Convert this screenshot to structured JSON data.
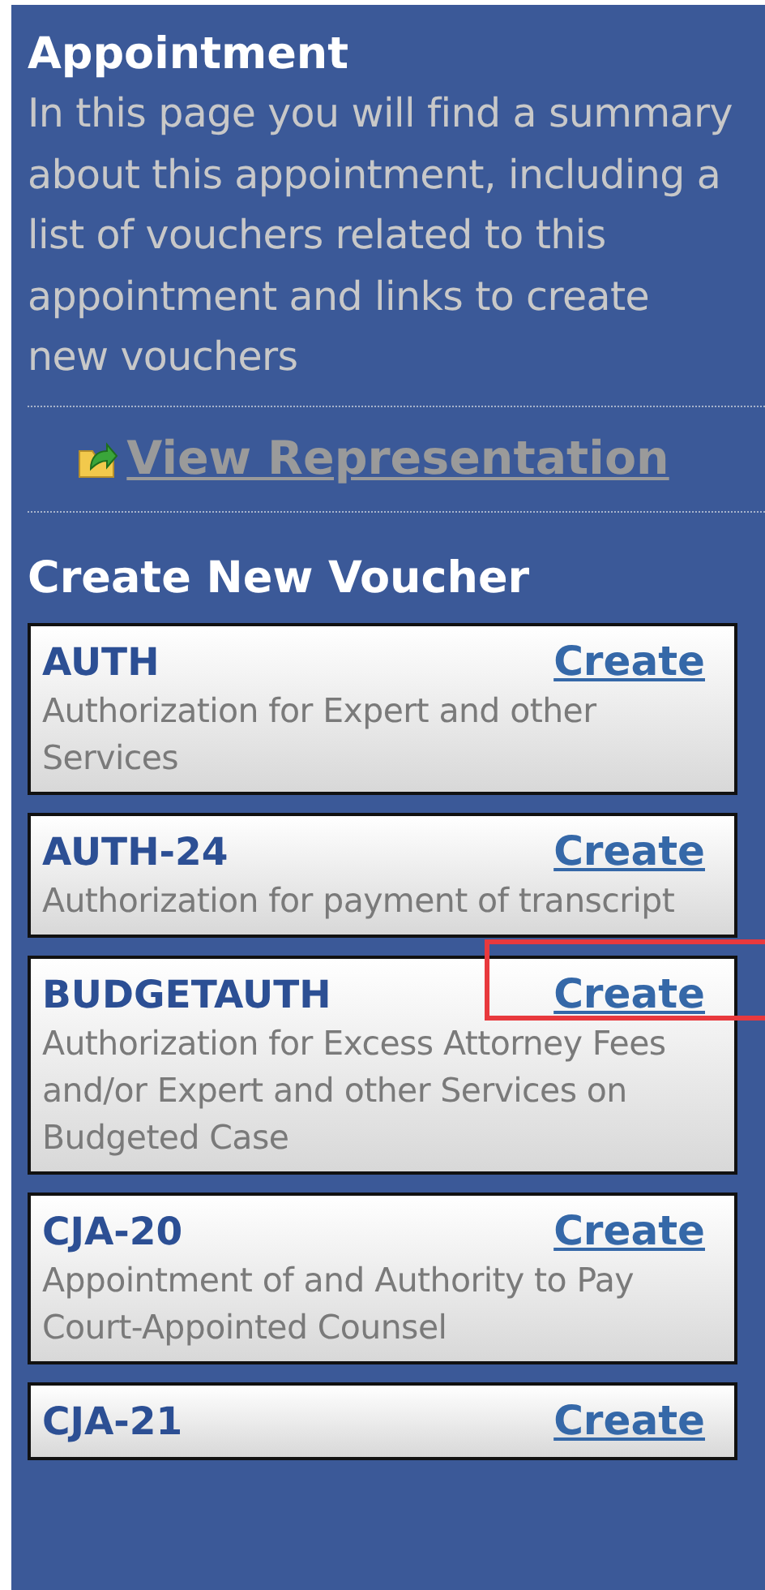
{
  "header": {
    "title": "Appointment",
    "description": "In this page you will find a summary about this appointment, including a list of vouchers related to this appointment and links to create new vouchers"
  },
  "view_link": "View Representation",
  "section_title": "Create New Voucher",
  "vouchers": [
    {
      "code": "AUTH",
      "action": "Create",
      "description": "Authorization for Expert and other Services",
      "highlighted": false
    },
    {
      "code": "AUTH-24",
      "action": "Create",
      "description": "Authorization for payment of transcript",
      "highlighted": false
    },
    {
      "code": "BUDGETAUTH",
      "action": "Create",
      "description": "Authorization for Excess Attorney Fees and/or Expert and other Services on Budgeted Case",
      "highlighted": true
    },
    {
      "code": "CJA-20",
      "action": "Create",
      "description": "Appointment of and Authority to Pay Court-Appointed Counsel",
      "highlighted": false
    },
    {
      "code": "CJA-21",
      "action": "Create",
      "highlighted": false
    }
  ]
}
